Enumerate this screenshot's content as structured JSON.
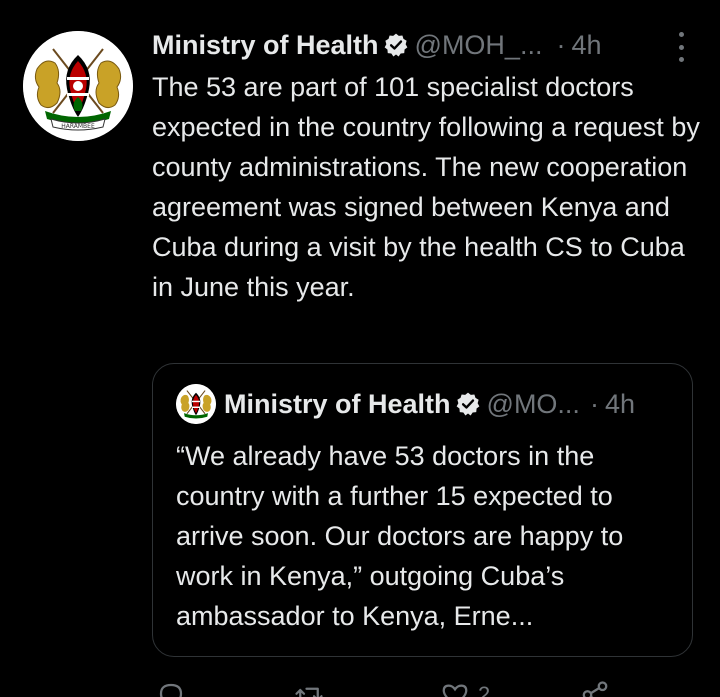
{
  "tweet": {
    "display_name": "Ministry of Health",
    "handle": "@MOH_...",
    "separator": "·",
    "time": "4h",
    "text": "The 53 are part of 101 specialist doctors expected in the country following a request by county administrations. The new cooperation agreement was signed between Kenya and Cuba during a visit by the health CS to Cuba in June this year.",
    "avatar_text": "HARAMBEE"
  },
  "quote": {
    "display_name": "Ministry of Health",
    "handle": "@MO...",
    "separator": "·",
    "time": "4h",
    "text": "“We already have 53 doctors in the country with a further 15 expected to arrive soon. Our doctors are happy to work in Kenya,” outgoing Cuba’s ambassador to Kenya, Erne..."
  },
  "actions": {
    "reply": {
      "icon": "reply-icon",
      "count": ""
    },
    "retweet": {
      "icon": "retweet-icon",
      "count": ""
    },
    "like": {
      "icon": "heart-icon",
      "count": "2"
    },
    "share": {
      "icon": "share-icon",
      "count": ""
    }
  },
  "colors": {
    "background": "#000000",
    "text": "#e7e9ea",
    "muted": "#71767b",
    "border": "#2f3336",
    "kenya_green": "#006600",
    "kenya_red": "#bb0000",
    "gold": "#c9a227"
  }
}
